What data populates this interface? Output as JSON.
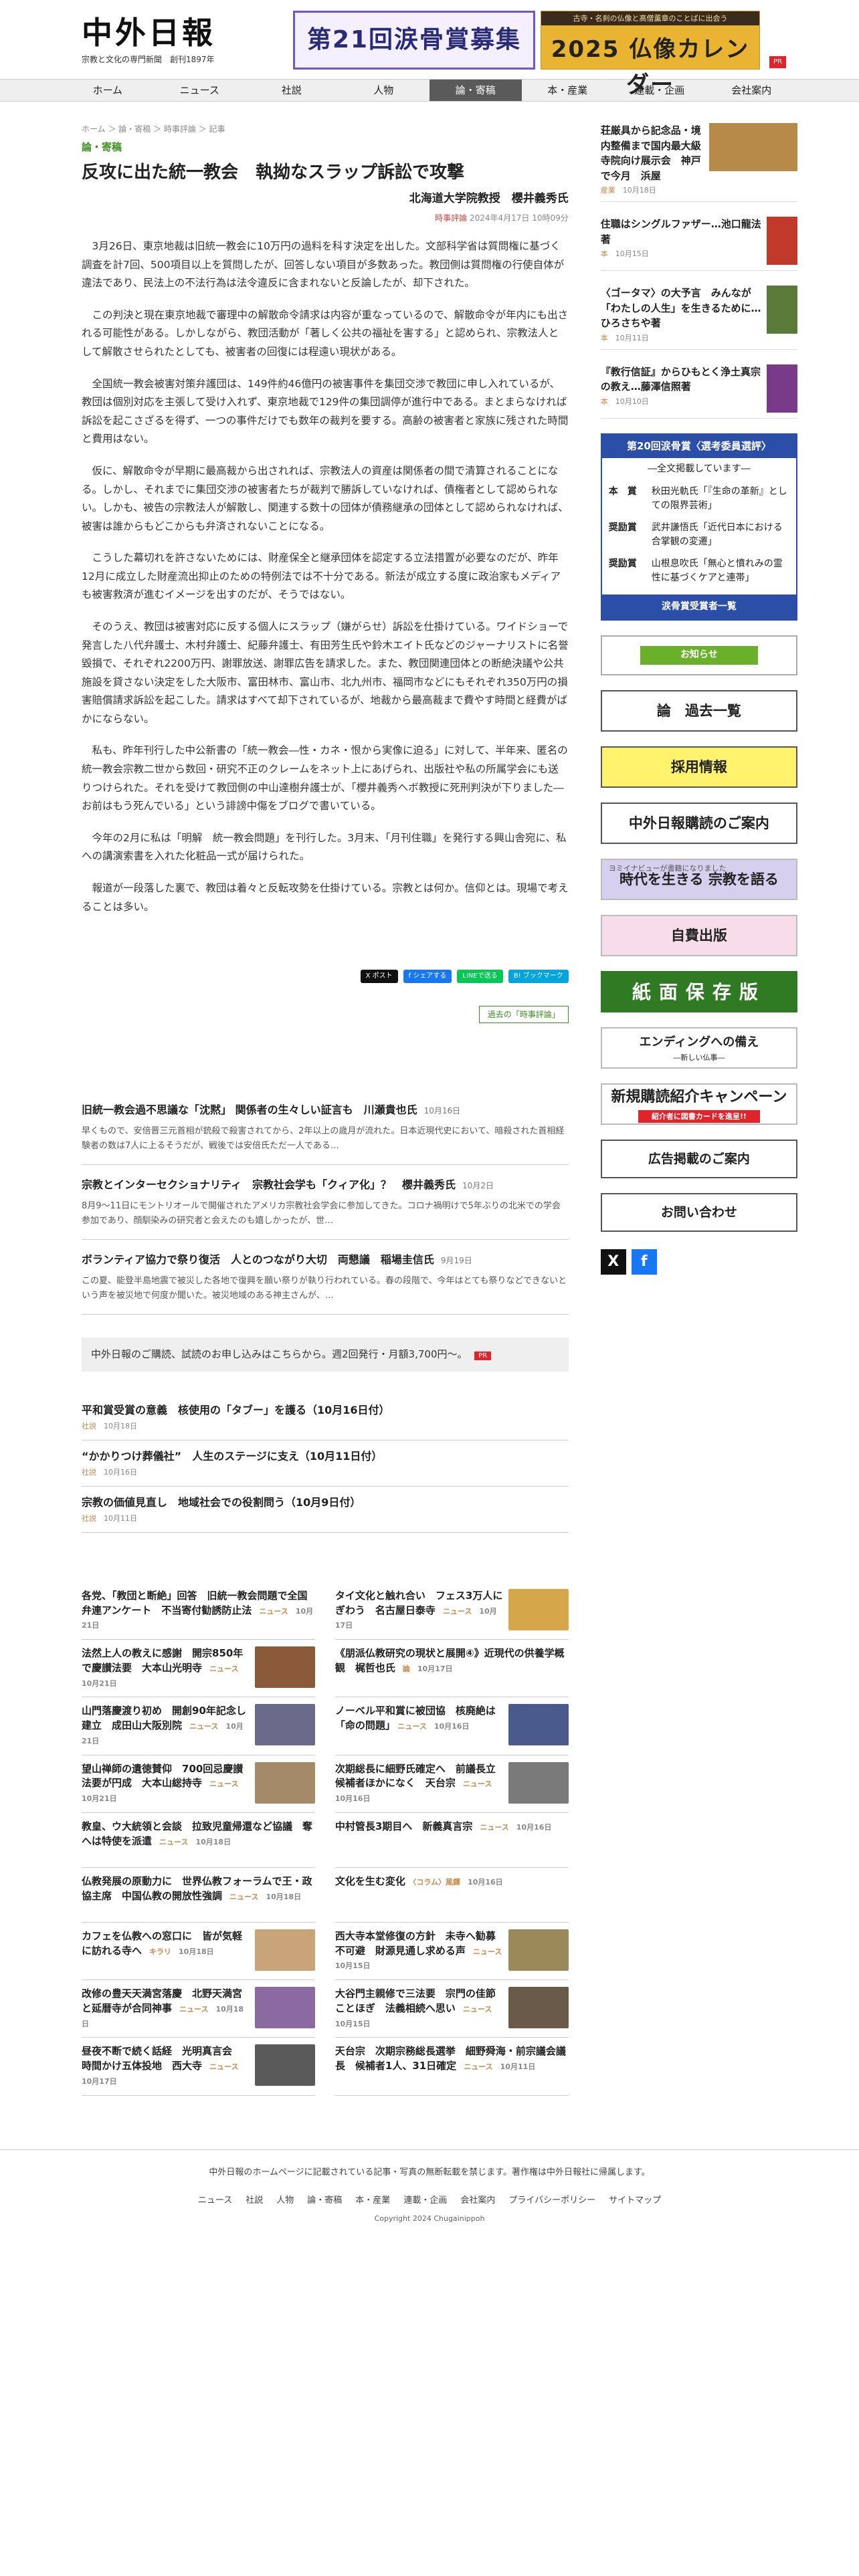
{
  "header": {
    "logo_title": "中外日報",
    "logo_sub": "宗教と文化の専門新聞　創刊1897年",
    "banner1": "第21回涙骨賞募集",
    "banner2_top": "古寺・名刹の仏像と高僧薫章のことばに出会う",
    "banner2_main": "2025 仏像カレンダー",
    "pr": "PR"
  },
  "nav": [
    "ホーム",
    "ニュース",
    "社説",
    "人物",
    "論・寄稿",
    "本・産業",
    "連載・企画",
    "会社案内"
  ],
  "article": {
    "breadcrumb": "ホーム ＞ 論・寄稿 ＞ 時事評論 ＞ 記事",
    "category": "論・寄稿",
    "title": "反攻に出た統一教会　執拗なスラップ訴訟で攻撃",
    "author": "北海道大学院教授　櫻井義秀氏",
    "meta_tag": "時事評論",
    "meta_date": "2024年4月17日 10時09分",
    "paragraphs": [
      "3月26日、東京地裁は旧統一教会に10万円の過料を科す決定を出した。文部科学省は質問権に基づく調査を計7回、500項目以上を質問したが、回答しない項目が多数あった。教団側は質問権の行使自体が違法であり、民法上の不法行為は法令違反に含まれないと反論したが、却下された。",
      "この判決と現在東京地裁で審理中の解散命令請求は内容が重なっているので、解散命令が年内にも出される可能性がある。しかしながら、教団活動が「著しく公共の福祉を害する」と認められ、宗教法人として解散させられたとしても、被害者の回復には程遠い現状がある。",
      "全国統一教会被害対策弁護団は、149件約46億円の被害事件を集団交渉で教団に申し入れているが、教団は個別対応を主張して受け入れず、東京地裁で129件の集団調停が進行中である。まとまらなければ訴訟を起こさざるを得ず、一つの事件だけでも数年の裁判を要する。高齢の被害者と家族に残された時間と費用はない。",
      "仮に、解散命令が早期に最高裁から出されれば、宗教法人の資産は関係者の間で清算されることになる。しかし、それまでに集団交渉の被害者たちが裁判で勝訴していなければ、債権者として認められない。しかも、被告の宗教法人が解散し、関連する数十の団体が債務継承の団体として認められなければ、被害は誰からもどこからも弁済されないことになる。",
      "こうした幕切れを許さないためには、財産保全と継承団体を認定する立法措置が必要なのだが、昨年12月に成立した財産流出抑止のための特例法では不十分である。新法が成立する度に政治家もメディアも被害救済が進むイメージを出すのだが、そうではない。",
      "そのうえ、教団は被害対応に反する個人にスラップ（嫌がらせ）訴訟を仕掛けている。ワイドショーで発言した八代弁護士、木村弁護士、紀藤弁護士、有田芳生氏や鈴木エイト氏などのジャーナリストに名誉毀損で、それぞれ2200万円、謝罪放送、謝罪広告を請求した。また、教団関連団体との断絶決議や公共施設を貸さない決定をした大阪市、富田林市、富山市、北九州市、福岡市などにもそれぞれ350万円の損害賠償請求訴訟を起こした。請求はすべて却下されているが、地裁から最高裁まで費やす時間と経費がばかにならない。",
      "私も、昨年刊行した中公新書の「統一教会―性・カネ・恨から実像に迫る」に対して、半年来、匿名の統一教会宗教二世から数回・研究不正のクレームをネット上にあげられ、出版社や私の所属学会にも送りつけられた。それを受けて教団側の中山達樹弁護士が、「櫻井義秀ヘボ教授に死刑判決が下りました―お前はもう死んでいる」という誹謗中傷をブログで書いている。",
      "今年の2月に私は「明解　統一教会問題」を刊行した。3月末、「月刊住職」を発行する興山舎宛に、私への講演索書を入れた化粧品一式が届けられた。",
      "報道が一段落した裏で、教団は着々と反転攻勢を仕掛けている。宗教とは何か。信仰とは。現場で考えることは多い。"
    ],
    "share": [
      "X ポスト",
      "f シェアする",
      "LINEで送る",
      "B! ブックマーク"
    ],
    "series_link": "過去の「時事評論」"
  },
  "related": [
    {
      "title": "旧統一教会過不思議な「沈黙」 関係者の生々しい証言も　川瀬貴也氏",
      "date": "10月16日",
      "excerpt": "早くもので、安倍晋三元首相が銃殺で殺害されてから、2年以上の歳月が流れた。日本近現代史において、暗殺された首相経験者の数は7人に上るそうだが、戦後では安倍氏ただ一人である…"
    },
    {
      "title": "宗教とインターセクショナリティ　宗教社会学も「クィア化」？　櫻井義秀氏",
      "date": "10月2日",
      "excerpt": "8月9〜11日にモントリオールで開催されたアメリカ宗教社会学会に参加してきた。コロナ禍明けで5年ぶりの北米での学会参加であり、顔馴染みの研究者と会えたのも嬉しかったが、世…"
    },
    {
      "title": "ボランティア協力で祭り復活　人とのつながり大切　両懇議　稲場圭信氏",
      "date": "9月19日",
      "excerpt": "この夏、能登半島地震で被災した各地で復興を願い祭りが執り行われている。春の段階で、今年はとても祭りなどできないという声を被災地で何度か聞いた。被災地域のある神主さんが、…"
    }
  ],
  "subscribe_bar": "中外日報のご購読、試読のお申し込みはこちらから。週2回発行・月額3,700円〜。",
  "subscribe_pr": "PR",
  "shorts": [
    {
      "title": "平和賞受賞の意義　核使用の「タブー」を護る（10月16日付）",
      "cat": "社説",
      "date": "10月18日"
    },
    {
      "title": "“かかりつけ葬儀社”　人生のステージに支え（10月11日付）",
      "cat": "社説",
      "date": "10月16日"
    },
    {
      "title": "宗教の価値見直し　地域社会での役割問う（10月9日付）",
      "cat": "社説",
      "date": "10月11日"
    }
  ],
  "grid": [
    {
      "title": "各党、「教団と断絶」回答　旧統一教会問題で全国弁連アンケート　不当寄付勧誘防止法",
      "cat": "ニュース",
      "date": "10月21日",
      "thumb": false
    },
    {
      "title": "タイ文化と触れ合い　フェス3万人にぎわう　名古屋日泰寺",
      "cat": "ニュース",
      "date": "10月17日",
      "thumb": true,
      "color": "#d6a64a"
    },
    {
      "title": "法然上人の教えに感謝　開宗850年で慶讃法要　大本山光明寺",
      "cat": "ニュース",
      "date": "10月21日",
      "thumb": true,
      "color": "#8a5a3a"
    },
    {
      "title": "《朋派仏教研究の現状と展開④》近現代の供養学概観　梶哲也氏",
      "cat": "論",
      "date": "10月17日",
      "thumb": false
    },
    {
      "title": "山門落慶渡り初め　開創90年記念し建立　成田山大阪別院",
      "cat": "ニュース",
      "date": "10月21日",
      "thumb": true,
      "color": "#6a6a8a"
    },
    {
      "title": "ノーベル平和賞に被団協　核廃絶は「命の問題」",
      "cat": "ニュース",
      "date": "10月16日",
      "thumb": true,
      "color": "#4a5a8a"
    },
    {
      "title": "望山禅師の遺徳賛仰　700回忌慶讃法要が円成　大本山総持寺",
      "cat": "ニュース",
      "date": "10月21日",
      "thumb": true,
      "color": "#a58a6a"
    },
    {
      "title": "次期総長に細野氏確定へ　前議長立候補者ほかになく　天台宗",
      "cat": "ニュース",
      "date": "10月16日",
      "thumb": true,
      "color": "#7a7a7a"
    },
    {
      "title": "教皇、ウ大統領と会談　拉致児童帰還など協議　奪へは特使を派遣",
      "cat": "ニュース",
      "date": "10月18日",
      "thumb": false
    },
    {
      "title": "中村管長3期目へ　新義真言宗",
      "cat": "ニュース",
      "date": "10月16日",
      "thumb": false
    },
    {
      "title": "仏教発展の原動力に　世界仏教フォーラムで王・政協主席　中国仏教の開放性強調",
      "cat": "ニュース",
      "date": "10月18日",
      "thumb": false
    },
    {
      "title": "文化を生む変化",
      "cat": "〈コラム〉風鐸",
      "date": "10月16日",
      "thumb": false
    },
    {
      "title": "カフェを仏教への窓口に　皆が気軽に訪れる寺へ",
      "cat": "キラリ",
      "date": "10月18日",
      "thumb": true,
      "color": "#c8a478"
    },
    {
      "title": "西大寺本堂修復の方針　未寺へ勧募不可避　財源見通し求める声",
      "cat": "ニュース",
      "date": "10月15日",
      "thumb": true,
      "color": "#9a8a5a"
    },
    {
      "title": "改修の豊天天満宮落慶　北野天満宮と延暦寺が合同神事",
      "cat": "ニュース",
      "date": "10月18日",
      "thumb": true,
      "color": "#8a6aa0"
    },
    {
      "title": "大谷門主親修で三法要　宗門の佳節ことほぎ　法義相続へ思い",
      "cat": "ニュース",
      "date": "10月15日",
      "thumb": true,
      "color": "#6a5a4a"
    },
    {
      "title": "昼夜不断で続く話経　光明真言会　時間かけ五体投地　西大寺",
      "cat": "ニュース",
      "date": "10月17日",
      "thumb": true,
      "color": "#5a5a5a"
    },
    {
      "title": "天台宗　次期宗務総長選挙　細野舜海・前宗議会議長　候補者1人、31日確定",
      "cat": "ニュース",
      "date": "10月11日",
      "thumb": false
    }
  ],
  "sidebar": {
    "items": [
      {
        "title": "荘厳具から記念品・境内整備まで国内最大級　寺院向け展示会　神戸で今月　浜屋",
        "cat": "産業",
        "date": "10月18日",
        "color": "#b88a4a",
        "small": false
      },
      {
        "title": "住職はシングルファザー…池口龍法著",
        "cat": "本",
        "date": "10月15日",
        "color": "#c0392b",
        "small": true
      },
      {
        "title": "〈ゴータマ〉の大予言　みんなが「わたしの人生」を生きるために…ひろさちや著",
        "cat": "本",
        "date": "10月11日",
        "color": "#5a7a3a",
        "small": true
      },
      {
        "title": "『教行信証』からひもとく浄土真宗の教え…藤澤信照著",
        "cat": "本",
        "date": "10月10日",
        "color": "#7a3a8a",
        "small": true
      }
    ],
    "award": {
      "header": "第20回涙骨賞〈選考委員選評〉",
      "sub": "―全文掲載しています―",
      "rows": [
        {
          "k": "本　賞",
          "v": "秋田光軌氏「『生命の革新』としての限界芸術」"
        },
        {
          "k": "奨励賞",
          "v": "武井謙悟氏「近代日本における合掌観の変遷」"
        },
        {
          "k": "奨励賞",
          "v": "山根息吹氏「無心と憤れみの霊性に基づくケアと連帯」"
        }
      ],
      "footer": "涙骨賞受賞者一覧"
    },
    "notice": "お知らせ",
    "archive": "論　過去一覧",
    "recruit": "採用情報",
    "subscribe_guide": "中外日報購読のご案内",
    "jidai_cap": "ヨミイナビューが書籍になりました",
    "jidai": "時代を生きる 宗教を語る",
    "selfpub": "自費出版",
    "storage": "紙面保存版",
    "ending": "エンディングへの備え",
    "ending_sub": "―新しい仏事―",
    "campaign": "新規購読紹介キャンペーン",
    "campaign_sub": "紹介者に図書カードを進呈!!",
    "ad": "広告掲載のご案内",
    "contact": "お問い合わせ",
    "x_icon": "X",
    "fb_icon": "f"
  },
  "footer": {
    "notice": "中外日報のホームページに記載されている記事・写真の無断転載を禁じます。著作権は中外日報社に帰属します。",
    "links": [
      "ニュース",
      "社説",
      "人物",
      "論・寄稿",
      "本・産業",
      "連載・企画",
      "会社案内",
      "プライバシーポリシー",
      "サイトマップ"
    ],
    "copyright": "Copyright 2024 Chugainippoh"
  }
}
